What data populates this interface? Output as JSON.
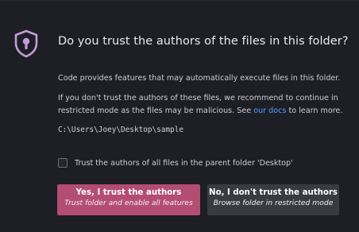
{
  "dialog": {
    "title": "Do you trust the authors of the files in this folder?",
    "paragraph1": "Code provides features that may automatically execute files in this folder.",
    "paragraph2_line1": "If you don't trust the authors of these files, we recommend to continue in",
    "paragraph2_line2_before": "restricted mode as the files may be malicious. See ",
    "paragraph2_link": "our docs",
    "paragraph2_line2_after": " to learn more.",
    "folder_path": "C:\\Users\\Joey\\Desktop\\sample",
    "parent_trust_checkbox": {
      "label": "Trust the authors of all files in the parent folder 'Desktop'",
      "checked": false
    },
    "trust_button": {
      "label": "Yes, I trust the authors",
      "sublabel": "Trust folder and enable all features"
    },
    "distrust_button": {
      "label": "No, I don't trust the authors",
      "sublabel": "Browse folder in restricted mode"
    },
    "icon": "shield-lock-icon",
    "colors": {
      "accent": "#b44d72",
      "link": "#4ea3ff",
      "icon": "#c39bd8",
      "background": "#1e1e25",
      "secondary_button": "#3a3a42"
    }
  }
}
